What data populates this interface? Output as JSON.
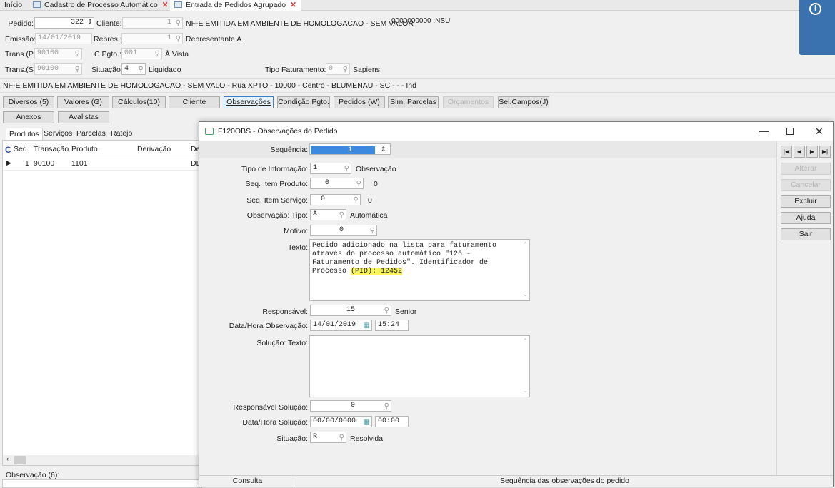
{
  "tabs": [
    {
      "label": "Início"
    },
    {
      "label": "Cadastro de Processo Automático"
    },
    {
      "label": "Entrada de Pedidos Agrupado"
    }
  ],
  "form": {
    "pedido_label": "Pedido:",
    "pedido_value": "322",
    "cliente_label": "Cliente:",
    "cliente_value": "1",
    "cliente_name": "NF-E EMITIDA EM AMBIENTE DE HOMOLOGACAO - SEM VALOR",
    "nsu": "0000000000 :NSU",
    "emissao_label": "Emissão:",
    "emissao_value": "14/01/2019",
    "repres_label": "Repres.:",
    "repres_value": "1",
    "repres_name": "Representante A",
    "transp_label": "Trans.(P):",
    "transp_value": "90100",
    "cpgto_label": "C.Pgto.:",
    "cpgto_value": "001",
    "cpgto_name": "À Vista",
    "transs_label": "Trans.(S):",
    "transs_value": "90100",
    "situacao_label": "Situação:",
    "situacao_value": "4",
    "situacao_name": "Liquidado",
    "tipofat_label": "Tipo Faturamento:",
    "tipofat_value": "0",
    "tipofat_name": "Sapiens",
    "address": "NF-E EMITIDA EM AMBIENTE DE HOMOLOGACAO - SEM VALO - Rua XPTO - 10000 - Centro - BLUMENAU - SC -  -  - Ind"
  },
  "buttons": [
    "Diversos (5)",
    "Valores (G)",
    "Cálculos(10)",
    "Cliente",
    "Observações",
    "Condição Pgto.",
    "Pedidos (W)",
    "Sim. Parcelas",
    "Orçamentos",
    "Sel.Campos(J)",
    "Anexos",
    "Avalistas"
  ],
  "subtabs": [
    "Produtos",
    "Serviços",
    "Parcelas",
    "Ratejo"
  ],
  "grid": {
    "columns": [
      "C",
      "Seq.",
      "Transação",
      "Produto",
      "Derivação",
      "De"
    ],
    "rows": [
      {
        "seq": "1",
        "transacao": "90100",
        "produto": "1101",
        "derivacao": "",
        "de": "DE"
      }
    ]
  },
  "observacao_label": "Observação (6):",
  "dialog": {
    "title": "F120OBS - Observações do Pedido",
    "sequencia_label": "Sequência:",
    "sequencia_value": "1",
    "tipo_info_label": "Tipo de Informação:",
    "tipo_info_value": "1",
    "tipo_info_name": "Observação",
    "seq_prod_label": "Seq. Item Produto:",
    "seq_prod_value": "0",
    "seq_prod_desc": "0",
    "seq_serv_label": "Seq. Item Serviço:",
    "seq_serv_value": "0",
    "seq_serv_desc": "0",
    "obs_tipo_label": "Observação: Tipo:",
    "obs_tipo_value": "A",
    "obs_tipo_name": "Automática",
    "motivo_label": "Motivo:",
    "motivo_value": "0",
    "texto_label": "Texto:",
    "texto_value": "Pedido adicionado na lista para faturamento através do processo automático \"126 - Faturamento de Pedidos\". Identificador de Processo ",
    "texto_highlight": "(PID): 12452",
    "resp_label": "Responsável:",
    "resp_value": "15",
    "resp_name": "Senior",
    "datahora_obs_label": "Data/Hora Observação:",
    "data_obs": "14/01/2019",
    "hora_obs": "15:24",
    "solucao_label": "Solução: Texto:",
    "solucao_value": "",
    "resp_sol_label": "Responsável Solução:",
    "resp_sol_value": "0",
    "datahora_sol_label": "Data/Hora Solução:",
    "data_sol": "00/00/0000",
    "hora_sol": "00:00",
    "situacao_label": "Situação:",
    "situacao_value": "R",
    "situacao_name": "Resolvida",
    "side_buttons": [
      "Alterar",
      "Cancelar",
      "Excluir",
      "Ajuda",
      "Sair"
    ],
    "status_mode": "Consulta",
    "status_msg": "Sequência das observações do pedido"
  },
  "colors": {
    "info": "#3a72b0",
    "highlight": "#f6f55a",
    "selection": "#3c8ae0"
  }
}
